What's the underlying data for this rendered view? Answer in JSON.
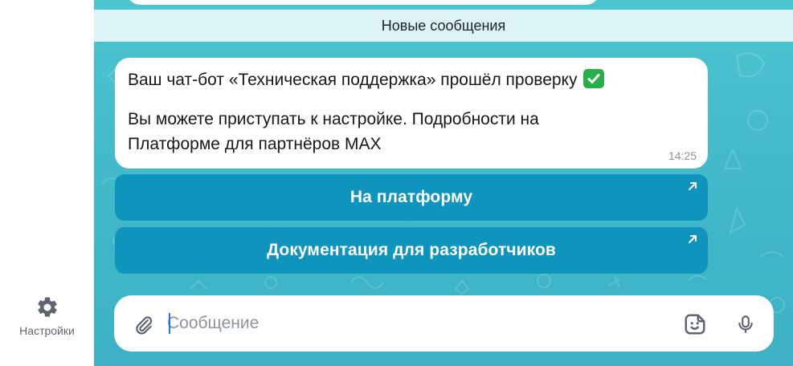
{
  "sidebar": {
    "settings": {
      "label": "Настройки",
      "icon": "gear-icon"
    }
  },
  "chat": {
    "divider": "Новые сообщения",
    "message": {
      "line1": "Ваш чат-бот «Техническая поддержка» прошёл проверку",
      "line1_emoji": "check-mark-button-icon",
      "line2": "Вы можете приступать к настройке. Подробности на",
      "line3": "Платформе для партнёров MAX",
      "time": "14:25"
    },
    "buttons": [
      {
        "label": "На платформу",
        "icon": "external-link-arrow-icon"
      },
      {
        "label": "Документация для разработчиков",
        "icon": "external-link-arrow-icon"
      }
    ]
  },
  "composer": {
    "placeholder": "Сообщение",
    "value": "",
    "icons": [
      "paperclip-icon",
      "sticker-icon",
      "microphone-icon"
    ]
  },
  "colors": {
    "chat_background": "#45bccb",
    "button_background": "#0f94bd",
    "check_green": "#27b04a"
  }
}
